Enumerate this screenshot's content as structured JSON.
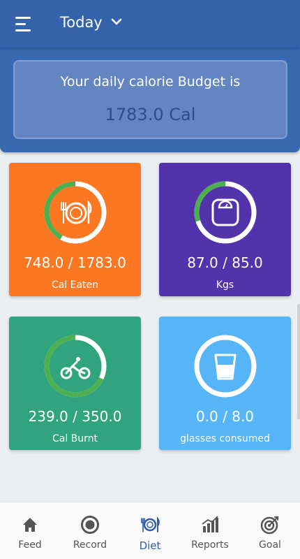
{
  "header": {
    "period_label": "Today"
  },
  "budget": {
    "title": "Your daily calorie Budget is",
    "value": "1783.0 Cal"
  },
  "tiles": [
    {
      "id": "cal-eaten",
      "value": "748.0 / 1783.0",
      "label": "Cal Eaten",
      "progress": 0.42,
      "color": "#fb7722",
      "icon": "plate-cutlery-icon"
    },
    {
      "id": "weight",
      "value": "87.0 / 85.0",
      "label": "Kgs",
      "progress": 0.3,
      "color": "#5233ab",
      "icon": "weighing-scale-icon"
    },
    {
      "id": "cal-burnt",
      "value": "239.0 / 350.0",
      "label": "Cal Burnt",
      "progress": 0.68,
      "color": "#30a47f",
      "icon": "bicycle-icon"
    },
    {
      "id": "water",
      "value": "0.0 / 8.0",
      "label": "glasses consumed",
      "progress": 0.0,
      "color": "#55b5f6",
      "icon": "glass-icon"
    }
  ],
  "colors": {
    "ring_track": "#ffffff",
    "ring_progress": "#4caf50",
    "nav_active": "#2f5fa8",
    "nav_inactive": "#555555"
  },
  "nav": {
    "active": "Diet",
    "items": [
      {
        "label": "Feed",
        "icon": "home-icon"
      },
      {
        "label": "Record",
        "icon": "record-icon"
      },
      {
        "label": "Diet",
        "icon": "plate-cutlery-icon"
      },
      {
        "label": "Reports",
        "icon": "bar-chart-icon"
      },
      {
        "label": "Goal",
        "icon": "target-icon"
      }
    ]
  }
}
